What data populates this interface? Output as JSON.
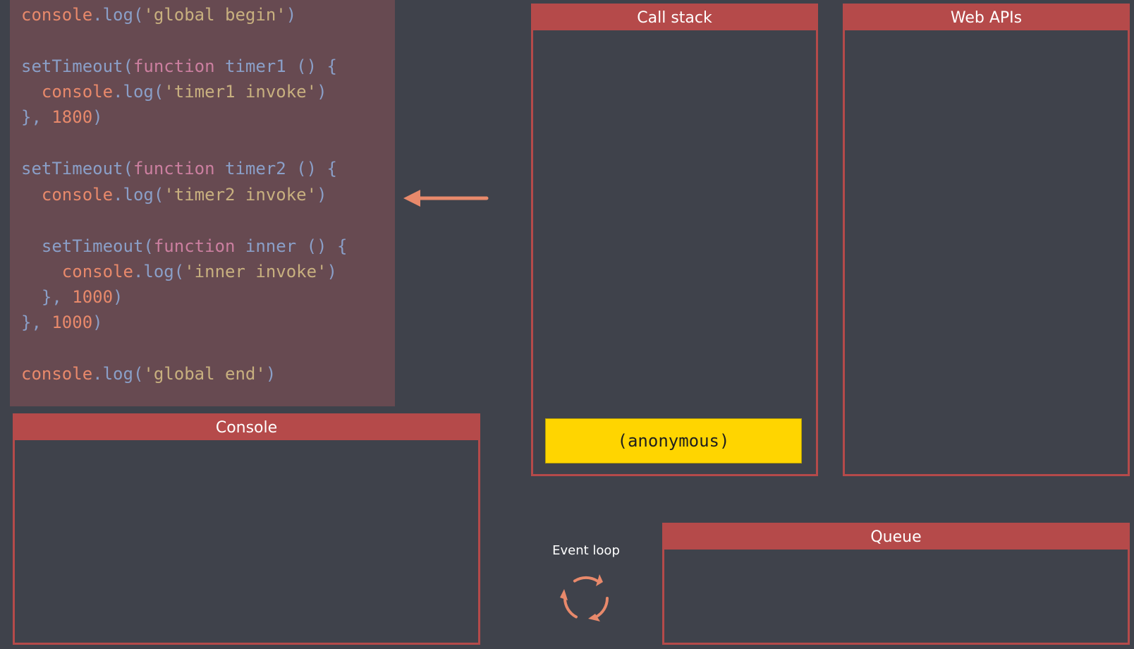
{
  "code": {
    "lines": [
      {
        "tokens": [
          {
            "t": "console",
            "c": "id"
          },
          {
            "t": ".",
            "c": "punc"
          },
          {
            "t": "log",
            "c": "fn"
          },
          {
            "t": "(",
            "c": "punc"
          },
          {
            "t": "'global begin'",
            "c": "str"
          },
          {
            "t": ")",
            "c": "punc"
          }
        ]
      },
      {
        "tokens": [
          {
            "t": "setTimeout",
            "c": "fn"
          },
          {
            "t": "(",
            "c": "punc"
          },
          {
            "t": "function",
            "c": "kw"
          },
          {
            "t": " ",
            "c": "punc"
          },
          {
            "t": "timer1",
            "c": "fn"
          },
          {
            "t": " () {",
            "c": "punc"
          }
        ]
      },
      {
        "tokens": [
          {
            "t": "  ",
            "c": "punc"
          },
          {
            "t": "console",
            "c": "id"
          },
          {
            "t": ".",
            "c": "punc"
          },
          {
            "t": "log",
            "c": "fn"
          },
          {
            "t": "(",
            "c": "punc"
          },
          {
            "t": "'timer1 invoke'",
            "c": "str"
          },
          {
            "t": ")",
            "c": "punc"
          }
        ]
      },
      {
        "tokens": [
          {
            "t": "}, ",
            "c": "punc"
          },
          {
            "t": "1800",
            "c": "num"
          },
          {
            "t": ")",
            "c": "punc"
          }
        ]
      },
      {
        "tokens": [
          {
            "t": "setTimeout",
            "c": "fn"
          },
          {
            "t": "(",
            "c": "punc"
          },
          {
            "t": "function",
            "c": "kw"
          },
          {
            "t": " ",
            "c": "punc"
          },
          {
            "t": "timer2",
            "c": "fn"
          },
          {
            "t": " () {",
            "c": "punc"
          }
        ]
      },
      {
        "tokens": [
          {
            "t": "  ",
            "c": "punc"
          },
          {
            "t": "console",
            "c": "id"
          },
          {
            "t": ".",
            "c": "punc"
          },
          {
            "t": "log",
            "c": "fn"
          },
          {
            "t": "(",
            "c": "punc"
          },
          {
            "t": "'timer2 invoke'",
            "c": "str"
          },
          {
            "t": ")",
            "c": "punc"
          }
        ]
      },
      {
        "tokens": [
          {
            "t": "  ",
            "c": "punc"
          },
          {
            "t": "setTimeout",
            "c": "fn"
          },
          {
            "t": "(",
            "c": "punc"
          },
          {
            "t": "function",
            "c": "kw"
          },
          {
            "t": " ",
            "c": "punc"
          },
          {
            "t": "inner",
            "c": "fn"
          },
          {
            "t": " () {",
            "c": "punc"
          }
        ]
      },
      {
        "tokens": [
          {
            "t": "    ",
            "c": "punc"
          },
          {
            "t": "console",
            "c": "id"
          },
          {
            "t": ".",
            "c": "punc"
          },
          {
            "t": "log",
            "c": "fn"
          },
          {
            "t": "(",
            "c": "punc"
          },
          {
            "t": "'inner invoke'",
            "c": "str"
          },
          {
            "t": ")",
            "c": "punc"
          }
        ]
      },
      {
        "tokens": [
          {
            "t": "  }, ",
            "c": "punc"
          },
          {
            "t": "1000",
            "c": "num"
          },
          {
            "t": ")",
            "c": "punc"
          }
        ]
      },
      {
        "tokens": [
          {
            "t": "}, ",
            "c": "punc"
          },
          {
            "t": "1000",
            "c": "num"
          },
          {
            "t": ")",
            "c": "punc"
          }
        ]
      },
      {
        "tokens": [
          {
            "t": "console",
            "c": "id"
          },
          {
            "t": ".",
            "c": "punc"
          },
          {
            "t": "log",
            "c": "fn"
          },
          {
            "t": "(",
            "c": "punc"
          },
          {
            "t": "'global end'",
            "c": "str"
          },
          {
            "t": ")",
            "c": "punc"
          }
        ]
      }
    ]
  },
  "current_line_marker": {
    "line": 6,
    "icon": "arrow-left-icon"
  },
  "call_stack": {
    "title": "Call stack",
    "frames": [
      "(anonymous)"
    ]
  },
  "web_apis": {
    "title": "Web APIs"
  },
  "console": {
    "title": "Console"
  },
  "queue": {
    "title": "Queue"
  },
  "event_loop": {
    "label": "Event loop",
    "icon": "refresh-cycle-icon"
  },
  "colors": {
    "background": "#3f424b",
    "code_panel": "#674a51",
    "box_accent": "#b54a4a",
    "stack_frame": "#ffd500",
    "arrow": "#e8896b"
  }
}
